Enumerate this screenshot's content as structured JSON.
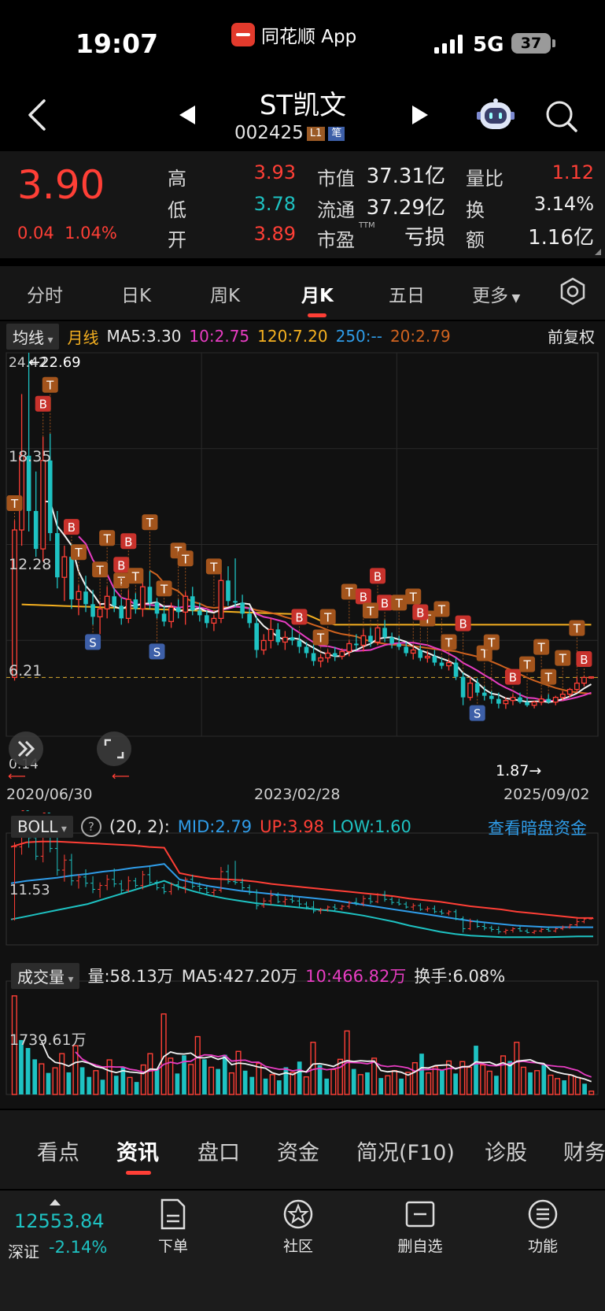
{
  "status": {
    "time": "19:07",
    "app_label": "同花顺 App",
    "network": "5G",
    "battery": "37"
  },
  "header": {
    "title": "ST凯文",
    "code": "002425",
    "tag_l1": "L1",
    "tag_bi": "笔"
  },
  "quote": {
    "price": "3.90",
    "change": "0.04",
    "change_pct": "1.04%",
    "high_label": "高",
    "high": "3.93",
    "low_label": "低",
    "low": "3.78",
    "open_label": "开",
    "open": "3.89",
    "mktcap_label": "市值",
    "mktcap": "37.31亿",
    "float_label": "流通",
    "float": "37.29亿",
    "pe_label": "市盈",
    "pe_sup": "TTM",
    "pe": "亏损",
    "volratio_label": "量比",
    "volratio": "1.12",
    "turnover_label": "换",
    "turnover": "3.14%",
    "amount_label": "额",
    "amount": "1.16亿"
  },
  "tabs": [
    {
      "label": "分时"
    },
    {
      "label": "日K"
    },
    {
      "label": "周K"
    },
    {
      "label": "月K"
    },
    {
      "label": "五日"
    },
    {
      "label": "更多"
    }
  ],
  "legend": {
    "selector": "均线",
    "period": "月线",
    "ma5": "MA5:3.30",
    "ma10": "10:2.75",
    "ma120": "120:7.20",
    "ma250": "250:--",
    "ma20": "20:2.79",
    "adjust": "前复权"
  },
  "boll": {
    "selector": "BOLL",
    "params": "(20, 2):",
    "mid": "MID:2.79",
    "up": "UP:3.98",
    "low": "LOW:1.60",
    "link": "查看暗盘资金"
  },
  "volume": {
    "selector": "成交量",
    "vol": "量:58.13万",
    "ma5": "MA5:427.20万",
    "ma10": "10:466.82万",
    "turnover": "换手:6.08%"
  },
  "chart_data": [
    {
      "type": "candlestick",
      "title": "",
      "y_ticks": [
        "24.42",
        "18.35",
        "12.28",
        "6.21",
        "0.14"
      ],
      "max_label": "22.69",
      "min_label": "1.87",
      "x_ticks": [
        "2020/06/30",
        "2023/02/28",
        "2025/09/02"
      ],
      "ylim": [
        0.14,
        24.42
      ],
      "ref_line": 3.86,
      "ma_colors": {
        "ma5": "#f2f2f2",
        "ma10": "#e83dc3",
        "ma20": "#d0631f",
        "ma120": "#f5b020",
        "ma250": "#2f9ce8"
      },
      "candles": [
        {
          "o": 3.86,
          "h": 13.8,
          "l": 3.66,
          "c": 13.2
        },
        {
          "o": 13.2,
          "h": 21.8,
          "l": 12.2,
          "c": 17.9
        },
        {
          "o": 17.9,
          "h": 24.42,
          "l": 13.1,
          "c": 14.4
        },
        {
          "o": 14.4,
          "h": 16.9,
          "l": 11.5,
          "c": 12.0
        },
        {
          "o": 12.0,
          "h": 19.1,
          "l": 11.2,
          "c": 17.6
        },
        {
          "o": 17.6,
          "h": 19.3,
          "l": 12.5,
          "c": 13.0
        },
        {
          "o": 13.0,
          "h": 14.4,
          "l": 9.5,
          "c": 10.2
        },
        {
          "o": 10.2,
          "h": 12.2,
          "l": 8.7,
          "c": 11.5
        },
        {
          "o": 11.5,
          "h": 12.3,
          "l": 8.2,
          "c": 8.8
        },
        {
          "o": 8.8,
          "h": 9.7,
          "l": 7.8,
          "c": 9.3
        },
        {
          "o": 9.3,
          "h": 10.3,
          "l": 8.0,
          "c": 8.5
        },
        {
          "o": 8.5,
          "h": 9.4,
          "l": 7.2,
          "c": 7.7
        },
        {
          "o": 7.7,
          "h": 8.6,
          "l": 6.6,
          "c": 8.2
        },
        {
          "o": 8.2,
          "h": 9.6,
          "l": 7.6,
          "c": 9.0
        },
        {
          "o": 9.0,
          "h": 10.4,
          "l": 8.0,
          "c": 8.4
        },
        {
          "o": 8.4,
          "h": 8.9,
          "l": 7.2,
          "c": 7.6
        },
        {
          "o": 7.6,
          "h": 9.4,
          "l": 7.3,
          "c": 8.8
        },
        {
          "o": 8.8,
          "h": 9.2,
          "l": 7.9,
          "c": 8.2
        },
        {
          "o": 8.2,
          "h": 10.1,
          "l": 7.7,
          "c": 9.6
        },
        {
          "o": 9.6,
          "h": 10.6,
          "l": 8.2,
          "c": 8.6
        },
        {
          "o": 8.6,
          "h": 8.9,
          "l": 7.6,
          "c": 7.9
        },
        {
          "o": 7.9,
          "h": 8.4,
          "l": 7.1,
          "c": 7.4
        },
        {
          "o": 7.4,
          "h": 8.6,
          "l": 7.0,
          "c": 8.3
        },
        {
          "o": 8.3,
          "h": 8.8,
          "l": 7.6,
          "c": 8.0
        },
        {
          "o": 8.0,
          "h": 9.3,
          "l": 7.2,
          "c": 9.0
        },
        {
          "o": 9.0,
          "h": 9.6,
          "l": 7.8,
          "c": 8.1
        },
        {
          "o": 8.1,
          "h": 8.6,
          "l": 7.4,
          "c": 7.8
        },
        {
          "o": 7.8,
          "h": 8.1,
          "l": 7.0,
          "c": 7.3
        },
        {
          "o": 7.3,
          "h": 7.8,
          "l": 6.8,
          "c": 7.6
        },
        {
          "o": 7.6,
          "h": 10.6,
          "l": 7.3,
          "c": 10.0
        },
        {
          "o": 10.0,
          "h": 10.9,
          "l": 8.4,
          "c": 8.7
        },
        {
          "o": 8.7,
          "h": 11.4,
          "l": 8.3,
          "c": 8.6
        },
        {
          "o": 8.6,
          "h": 9.1,
          "l": 7.6,
          "c": 7.9
        },
        {
          "o": 7.9,
          "h": 8.3,
          "l": 7.0,
          "c": 7.3
        },
        {
          "o": 7.3,
          "h": 7.7,
          "l": 5.1,
          "c": 5.6
        },
        {
          "o": 5.6,
          "h": 6.6,
          "l": 5.3,
          "c": 6.2
        },
        {
          "o": 6.2,
          "h": 7.6,
          "l": 5.7,
          "c": 6.9
        },
        {
          "o": 6.9,
          "h": 7.3,
          "l": 5.9,
          "c": 6.1
        },
        {
          "o": 6.1,
          "h": 6.8,
          "l": 5.6,
          "c": 6.4
        },
        {
          "o": 6.4,
          "h": 7.0,
          "l": 5.9,
          "c": 6.2
        },
        {
          "o": 6.2,
          "h": 6.6,
          "l": 5.4,
          "c": 5.8
        },
        {
          "o": 5.8,
          "h": 6.1,
          "l": 5.1,
          "c": 5.4
        },
        {
          "o": 5.4,
          "h": 6.2,
          "l": 4.6,
          "c": 4.9
        },
        {
          "o": 4.9,
          "h": 5.3,
          "l": 4.5,
          "c": 5.1
        },
        {
          "o": 5.1,
          "h": 5.6,
          "l": 4.8,
          "c": 5.4
        },
        {
          "o": 5.4,
          "h": 5.8,
          "l": 4.9,
          "c": 5.2
        },
        {
          "o": 5.2,
          "h": 5.7,
          "l": 5.0,
          "c": 5.5
        },
        {
          "o": 5.5,
          "h": 6.2,
          "l": 5.2,
          "c": 6.0
        },
        {
          "o": 6.0,
          "h": 6.6,
          "l": 5.6,
          "c": 5.9
        },
        {
          "o": 5.9,
          "h": 6.9,
          "l": 5.5,
          "c": 6.5
        },
        {
          "o": 6.5,
          "h": 7.0,
          "l": 5.8,
          "c": 6.1
        },
        {
          "o": 6.1,
          "h": 7.2,
          "l": 5.9,
          "c": 7.0
        },
        {
          "o": 7.0,
          "h": 7.5,
          "l": 6.1,
          "c": 6.4
        },
        {
          "o": 6.4,
          "h": 6.7,
          "l": 5.7,
          "c": 6.0
        },
        {
          "o": 6.0,
          "h": 6.5,
          "l": 5.6,
          "c": 5.8
        },
        {
          "o": 5.8,
          "h": 6.1,
          "l": 5.2,
          "c": 5.4
        },
        {
          "o": 5.4,
          "h": 5.9,
          "l": 5.0,
          "c": 5.6
        },
        {
          "o": 5.6,
          "h": 5.9,
          "l": 4.9,
          "c": 5.1
        },
        {
          "o": 5.1,
          "h": 5.5,
          "l": 4.8,
          "c": 5.2
        },
        {
          "o": 5.2,
          "h": 5.6,
          "l": 4.6,
          "c": 4.8
        },
        {
          "o": 4.8,
          "h": 5.1,
          "l": 4.4,
          "c": 4.6
        },
        {
          "o": 4.6,
          "h": 5.0,
          "l": 4.3,
          "c": 4.8
        },
        {
          "o": 4.8,
          "h": 5.1,
          "l": 3.7,
          "c": 3.9
        },
        {
          "o": 3.9,
          "h": 4.2,
          "l": 2.1,
          "c": 2.6
        },
        {
          "o": 2.6,
          "h": 3.9,
          "l": 2.4,
          "c": 3.5
        },
        {
          "o": 3.5,
          "h": 3.8,
          "l": 2.7,
          "c": 2.9
        },
        {
          "o": 2.9,
          "h": 3.3,
          "l": 2.4,
          "c": 2.7
        },
        {
          "o": 2.7,
          "h": 3.0,
          "l": 2.2,
          "c": 2.5
        },
        {
          "o": 2.5,
          "h": 2.9,
          "l": 1.9,
          "c": 2.2
        },
        {
          "o": 2.2,
          "h": 2.6,
          "l": 1.87,
          "c": 2.4
        },
        {
          "o": 2.4,
          "h": 2.8,
          "l": 2.1,
          "c": 2.6
        },
        {
          "o": 2.6,
          "h": 2.9,
          "l": 2.2,
          "c": 2.3
        },
        {
          "o": 2.3,
          "h": 2.6,
          "l": 2.0,
          "c": 2.1
        },
        {
          "o": 2.1,
          "h": 2.4,
          "l": 1.9,
          "c": 2.3
        },
        {
          "o": 2.3,
          "h": 2.7,
          "l": 2.1,
          "c": 2.5
        },
        {
          "o": 2.5,
          "h": 2.8,
          "l": 2.2,
          "c": 2.3
        },
        {
          "o": 2.3,
          "h": 2.7,
          "l": 2.1,
          "c": 2.6
        },
        {
          "o": 2.6,
          "h": 3.0,
          "l": 2.4,
          "c": 2.8
        },
        {
          "o": 2.8,
          "h": 3.2,
          "l": 2.6,
          "c": 3.1
        },
        {
          "o": 3.1,
          "h": 3.9,
          "l": 2.9,
          "c": 3.5
        },
        {
          "o": 3.5,
          "h": 3.93,
          "l": 3.3,
          "c": 3.86
        },
        {
          "o": 3.86,
          "h": 3.93,
          "l": 3.78,
          "c": 3.9
        }
      ],
      "signals": [
        {
          "i": 0,
          "t": "T"
        },
        {
          "i": 4,
          "t": "B"
        },
        {
          "i": 5,
          "t": "T"
        },
        {
          "i": 8,
          "t": "B"
        },
        {
          "i": 9,
          "t": "T"
        },
        {
          "i": 13,
          "t": "T"
        },
        {
          "i": 15,
          "t": "T"
        },
        {
          "i": 15,
          "t": "B"
        },
        {
          "i": 16,
          "t": "B"
        },
        {
          "i": 17,
          "t": "T"
        },
        {
          "i": 20,
          "t": "S"
        },
        {
          "i": 23,
          "t": "T"
        },
        {
          "i": 11,
          "t": "S"
        },
        {
          "i": 12,
          "t": "T"
        },
        {
          "i": 19,
          "t": "T"
        },
        {
          "i": 21,
          "t": "T"
        },
        {
          "i": 24,
          "t": "T"
        },
        {
          "i": 28,
          "t": "T"
        },
        {
          "i": 43,
          "t": "T"
        },
        {
          "i": 44,
          "t": "T"
        },
        {
          "i": 47,
          "t": "T"
        },
        {
          "i": 40,
          "t": "B"
        },
        {
          "i": 49,
          "t": "B"
        },
        {
          "i": 51,
          "t": "B"
        },
        {
          "i": 52,
          "t": "B"
        },
        {
          "i": 54,
          "t": "T"
        },
        {
          "i": 56,
          "t": "T"
        },
        {
          "i": 50,
          "t": "T"
        },
        {
          "i": 58,
          "t": "T"
        },
        {
          "i": 60,
          "t": "T"
        },
        {
          "i": 61,
          "t": "T"
        },
        {
          "i": 57,
          "t": "B"
        },
        {
          "i": 63,
          "t": "B"
        },
        {
          "i": 65,
          "t": "S"
        },
        {
          "i": 66,
          "t": "T"
        },
        {
          "i": 67,
          "t": "T"
        },
        {
          "i": 70,
          "t": "B"
        },
        {
          "i": 72,
          "t": "T"
        },
        {
          "i": 74,
          "t": "T"
        },
        {
          "i": 75,
          "t": "T"
        },
        {
          "i": 77,
          "t": "T"
        },
        {
          "i": 79,
          "t": "T"
        },
        {
          "i": 80,
          "t": "B"
        }
      ]
    },
    {
      "type": "line",
      "title": "",
      "y_ticks": [
        "11.53"
      ],
      "series": [
        {
          "name": "UP",
          "color": "#ff3f36",
          "values": [
            13.2,
            13.8,
            13.9,
            13.9,
            13.8,
            13.7,
            13.6,
            13.5,
            13.4,
            13.2,
            13.1,
            9.8,
            9.4,
            9.1,
            9.0,
            8.9,
            8.7,
            8.4,
            8.2,
            8.0,
            7.8,
            7.6,
            7.4,
            7.2,
            7.0,
            6.8,
            6.5,
            6.3,
            6.1,
            5.8,
            5.5,
            5.3,
            5.1,
            4.8,
            4.6,
            4.4,
            4.2,
            4.0,
            3.98
          ]
        },
        {
          "name": "MID",
          "color": "#2f9ce8",
          "values": [
            8.5,
            8.8,
            9.0,
            9.2,
            9.5,
            9.7,
            10.0,
            10.2,
            10.5,
            10.7,
            11.0,
            9.0,
            8.5,
            8.1,
            7.8,
            7.5,
            7.3,
            7.1,
            6.9,
            6.7,
            6.5,
            6.3,
            6.0,
            5.7,
            5.4,
            5.1,
            4.8,
            4.5,
            4.2,
            3.9,
            3.6,
            3.4,
            3.2,
            3.0,
            2.9,
            2.8,
            2.8,
            2.79,
            2.79
          ]
        },
        {
          "name": "LOW",
          "color": "#1ec2c2",
          "values": [
            3.8,
            4.2,
            4.6,
            5.0,
            5.4,
            5.8,
            6.4,
            7.0,
            7.6,
            8.2,
            8.8,
            8.0,
            7.4,
            6.9,
            6.5,
            6.2,
            5.9,
            5.7,
            5.5,
            5.3,
            5.1,
            4.9,
            4.6,
            4.3,
            3.9,
            3.5,
            3.0,
            2.6,
            2.2,
            1.9,
            1.7,
            1.6,
            1.5,
            1.5,
            1.5,
            1.5,
            1.55,
            1.6,
            1.6
          ]
        }
      ]
    },
    {
      "type": "bar",
      "title": "",
      "y_ticks": [
        "1739.61万"
      ],
      "values": [
        1739,
        960,
        820,
        620,
        540,
        380,
        470,
        720,
        390,
        860,
        480,
        310,
        420,
        260,
        610,
        330,
        480,
        300,
        220,
        520,
        720,
        450,
        1420,
        640,
        370,
        690,
        530,
        1020,
        620,
        480,
        450,
        700,
        380,
        760,
        420,
        310,
        550,
        280,
        350,
        250,
        480,
        390,
        580,
        310,
        920,
        520,
        280,
        440,
        620,
        1120,
        450,
        350,
        390,
        640,
        290,
        330,
        420,
        280,
        390,
        560,
        720,
        380,
        490,
        430,
        590,
        370,
        580,
        480,
        860,
        520,
        410,
        330,
        680,
        590,
        920,
        480,
        390,
        420,
        520,
        340,
        280,
        250,
        340,
        300,
        190,
        58
      ],
      "up": [
        1,
        0,
        0,
        0,
        1,
        0,
        1,
        1,
        0,
        1,
        0,
        0,
        1,
        0,
        1,
        0,
        0,
        1,
        0,
        1,
        1,
        0,
        1,
        1,
        0,
        0,
        1,
        1,
        0,
        1,
        0,
        0,
        1,
        1,
        0,
        0,
        1,
        0,
        1,
        0,
        0,
        1,
        0,
        1,
        1,
        0,
        0,
        1,
        1,
        1,
        0,
        1,
        0,
        1,
        0,
        1,
        1,
        0,
        1,
        1,
        0,
        1,
        1,
        0,
        1,
        0,
        1,
        1,
        0,
        1,
        1,
        0,
        1,
        0,
        1,
        1,
        0,
        1,
        0,
        1,
        1,
        0,
        1,
        1,
        0,
        1
      ],
      "ma5_color": "#f2f2f2",
      "ma10_color": "#e83dc3"
    }
  ],
  "bottom_tabs": [
    {
      "label": "看点"
    },
    {
      "label": "资讯"
    },
    {
      "label": "盘口"
    },
    {
      "label": "资金"
    },
    {
      "label": "简况(F10)"
    },
    {
      "label": "诊股"
    },
    {
      "label": "财务"
    }
  ],
  "index": {
    "value": "12553.84",
    "name": "深证",
    "change": "-2.14%"
  },
  "bottom_actions": [
    {
      "label": "下单"
    },
    {
      "label": "社区"
    },
    {
      "label": "删自选"
    },
    {
      "label": "功能"
    }
  ]
}
